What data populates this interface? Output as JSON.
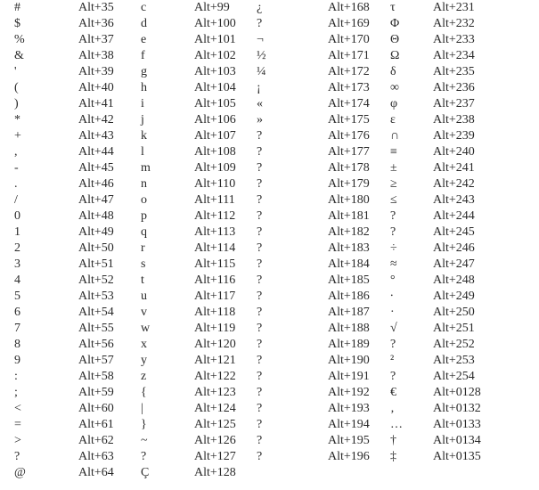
{
  "table": {
    "columns": [
      {
        "rows": [
          {
            "char": "#",
            "code": "Alt+35"
          },
          {
            "char": "$",
            "code": "Alt+36"
          },
          {
            "char": "%",
            "code": "Alt+37"
          },
          {
            "char": "&",
            "code": "Alt+38"
          },
          {
            "char": "'",
            "code": "Alt+39"
          },
          {
            "char": "(",
            "code": "Alt+40"
          },
          {
            "char": ")",
            "code": "Alt+41"
          },
          {
            "char": "*",
            "code": "Alt+42"
          },
          {
            "char": "+",
            "code": "Alt+43"
          },
          {
            "char": ",",
            "code": "Alt+44"
          },
          {
            "char": "-",
            "code": "Alt+45"
          },
          {
            "char": ".",
            "code": "Alt+46"
          },
          {
            "char": "/",
            "code": "Alt+47"
          },
          {
            "char": "0",
            "code": "Alt+48"
          },
          {
            "char": "1",
            "code": "Alt+49"
          },
          {
            "char": "2",
            "code": "Alt+50"
          },
          {
            "char": "3",
            "code": "Alt+51"
          },
          {
            "char": "4",
            "code": "Alt+52"
          },
          {
            "char": "5",
            "code": "Alt+53"
          },
          {
            "char": "6",
            "code": "Alt+54"
          },
          {
            "char": "7",
            "code": "Alt+55"
          },
          {
            "char": "8",
            "code": "Alt+56"
          },
          {
            "char": "9",
            "code": "Alt+57"
          },
          {
            "char": ":",
            "code": "Alt+58"
          },
          {
            "char": ";",
            "code": "Alt+59"
          },
          {
            "char": "<",
            "code": "Alt+60"
          },
          {
            "char": "=",
            "code": "Alt+61"
          },
          {
            "char": ">",
            "code": "Alt+62"
          },
          {
            "char": "?",
            "code": "Alt+63"
          },
          {
            "char": "@",
            "code": "Alt+64"
          }
        ]
      },
      {
        "rows": [
          {
            "char": "c",
            "code": "Alt+99"
          },
          {
            "char": "d",
            "code": "Alt+100"
          },
          {
            "char": "e",
            "code": "Alt+101"
          },
          {
            "char": "f",
            "code": "Alt+102"
          },
          {
            "char": "g",
            "code": "Alt+103"
          },
          {
            "char": "h",
            "code": "Alt+104"
          },
          {
            "char": "i",
            "code": "Alt+105"
          },
          {
            "char": "j",
            "code": "Alt+106"
          },
          {
            "char": "k",
            "code": "Alt+107"
          },
          {
            "char": "l",
            "code": "Alt+108"
          },
          {
            "char": "m",
            "code": "Alt+109"
          },
          {
            "char": "n",
            "code": "Alt+110"
          },
          {
            "char": "o",
            "code": "Alt+111"
          },
          {
            "char": "p",
            "code": "Alt+112"
          },
          {
            "char": "q",
            "code": "Alt+113"
          },
          {
            "char": "r",
            "code": "Alt+114"
          },
          {
            "char": "s",
            "code": "Alt+115"
          },
          {
            "char": "t",
            "code": "Alt+116"
          },
          {
            "char": "u",
            "code": "Alt+117"
          },
          {
            "char": "v",
            "code": "Alt+118"
          },
          {
            "char": "w",
            "code": "Alt+119"
          },
          {
            "char": "x",
            "code": "Alt+120"
          },
          {
            "char": "y",
            "code": "Alt+121"
          },
          {
            "char": "z",
            "code": "Alt+122"
          },
          {
            "char": "{",
            "code": "Alt+123"
          },
          {
            "char": "|",
            "code": "Alt+124"
          },
          {
            "char": "}",
            "code": "Alt+125"
          },
          {
            "char": "~",
            "code": "Alt+126"
          },
          {
            "char": "?",
            "code": "Alt+127"
          },
          {
            "char": "Ç",
            "code": "Alt+128"
          }
        ]
      },
      {
        "rows": [
          {
            "char": "¿",
            "code": "Alt+168"
          },
          {
            "char": "?",
            "code": "Alt+169"
          },
          {
            "char": "¬",
            "code": "Alt+170"
          },
          {
            "char": "½",
            "code": "Alt+171"
          },
          {
            "char": "¼",
            "code": "Alt+172"
          },
          {
            "char": "¡",
            "code": "Alt+173"
          },
          {
            "char": "«",
            "code": "Alt+174"
          },
          {
            "char": "»",
            "code": "Alt+175"
          },
          {
            "char": "?",
            "code": "Alt+176"
          },
          {
            "char": "?",
            "code": "Alt+177"
          },
          {
            "char": "?",
            "code": "Alt+178"
          },
          {
            "char": "?",
            "code": "Alt+179"
          },
          {
            "char": "?",
            "code": "Alt+180"
          },
          {
            "char": "?",
            "code": "Alt+181"
          },
          {
            "char": "?",
            "code": "Alt+182"
          },
          {
            "char": "?",
            "code": "Alt+183"
          },
          {
            "char": "?",
            "code": "Alt+184"
          },
          {
            "char": "?",
            "code": "Alt+185"
          },
          {
            "char": "?",
            "code": "Alt+186"
          },
          {
            "char": "?",
            "code": "Alt+187"
          },
          {
            "char": "?",
            "code": "Alt+188"
          },
          {
            "char": "?",
            "code": "Alt+189"
          },
          {
            "char": "?",
            "code": "Alt+190"
          },
          {
            "char": "?",
            "code": "Alt+191"
          },
          {
            "char": "?",
            "code": "Alt+192"
          },
          {
            "char": "?",
            "code": "Alt+193"
          },
          {
            "char": "?",
            "code": "Alt+194"
          },
          {
            "char": "?",
            "code": "Alt+195"
          },
          {
            "char": "?",
            "code": "Alt+196"
          }
        ]
      },
      {
        "rows": [
          {
            "char": "τ",
            "code": "Alt+231"
          },
          {
            "char": "Φ",
            "code": "Alt+232"
          },
          {
            "char": "Θ",
            "code": "Alt+233"
          },
          {
            "char": "Ω",
            "code": "Alt+234"
          },
          {
            "char": "δ",
            "code": "Alt+235"
          },
          {
            "char": "∞",
            "code": "Alt+236"
          },
          {
            "char": "φ",
            "code": "Alt+237"
          },
          {
            "char": "ε",
            "code": "Alt+238"
          },
          {
            "char": "∩",
            "code": "Alt+239"
          },
          {
            "char": "≡",
            "code": "Alt+240"
          },
          {
            "char": "±",
            "code": "Alt+241"
          },
          {
            "char": "≥",
            "code": "Alt+242"
          },
          {
            "char": "≤",
            "code": "Alt+243"
          },
          {
            "char": "?",
            "code": "Alt+244"
          },
          {
            "char": "?",
            "code": "Alt+245"
          },
          {
            "char": "÷",
            "code": "Alt+246"
          },
          {
            "char": "≈",
            "code": "Alt+247"
          },
          {
            "char": "°",
            "code": "Alt+248"
          },
          {
            "char": "∙",
            "code": "Alt+249"
          },
          {
            "char": "·",
            "code": "Alt+250"
          },
          {
            "char": "√",
            "code": "Alt+251"
          },
          {
            "char": "?",
            "code": "Alt+252"
          },
          {
            "char": "²",
            "code": "Alt+253"
          },
          {
            "char": "?",
            "code": "Alt+254"
          },
          {
            "char": "€",
            "code": "Alt+0128"
          },
          {
            "char": "‚",
            "code": "Alt+0132"
          },
          {
            "char": "…",
            "code": "Alt+0133"
          },
          {
            "char": "†",
            "code": "Alt+0134"
          },
          {
            "char": "‡",
            "code": "Alt+0135"
          }
        ]
      }
    ]
  }
}
